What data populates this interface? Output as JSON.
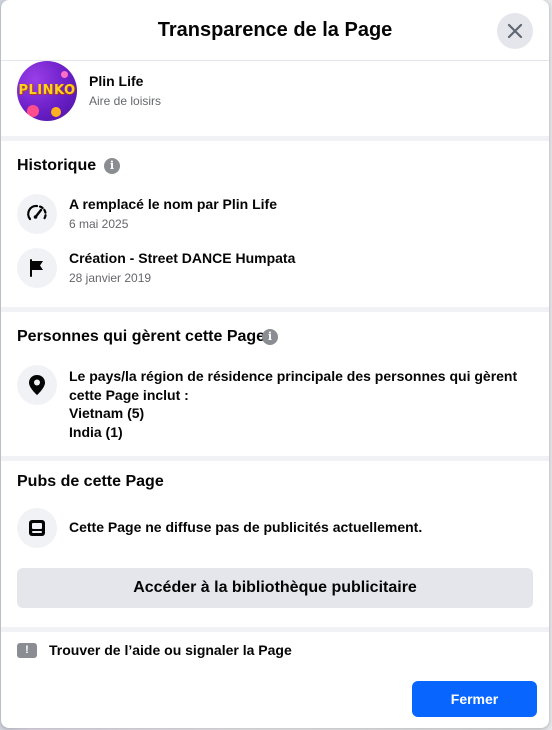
{
  "dialog": {
    "title": "Transparence de la Page",
    "close_icon": "close-icon"
  },
  "page": {
    "avatar_text": "PLINKO",
    "name": "Plin Life",
    "category": "Aire de loisirs"
  },
  "history": {
    "title": "Historique",
    "info_icon": "i",
    "items": [
      {
        "icon": "speedometer-icon",
        "text": "A remplacé le nom par Plin Life",
        "date": "6 mai 2025"
      },
      {
        "icon": "flag-icon",
        "text": "Création - Street DANCE Humpata",
        "date": "28 janvier 2019"
      }
    ]
  },
  "people": {
    "title": "Personnes qui gèrent cette Page",
    "info_icon": "i",
    "icon": "location-pin-icon",
    "description": "Le pays/la région de résidence principale des personnes qui gèrent cette Page inclut :",
    "countries": [
      "Vietnam (5)",
      "India (1)"
    ]
  },
  "ads": {
    "title": "Pubs de cette Page",
    "icon": "ad-screen-icon",
    "status": "Cette Page ne diffuse pas de publicités actuellement.",
    "library_button": "Accéder à la bibliothèque publicitaire"
  },
  "footer": {
    "help_icon": "!",
    "help_text": "Trouver de l’aide ou signaler la Page",
    "close_button": "Fermer"
  },
  "colors": {
    "primary": "#0866ff",
    "secondary_text": "#65676b",
    "button_gray": "#e4e6eb",
    "divider": "#f0f2f5"
  }
}
